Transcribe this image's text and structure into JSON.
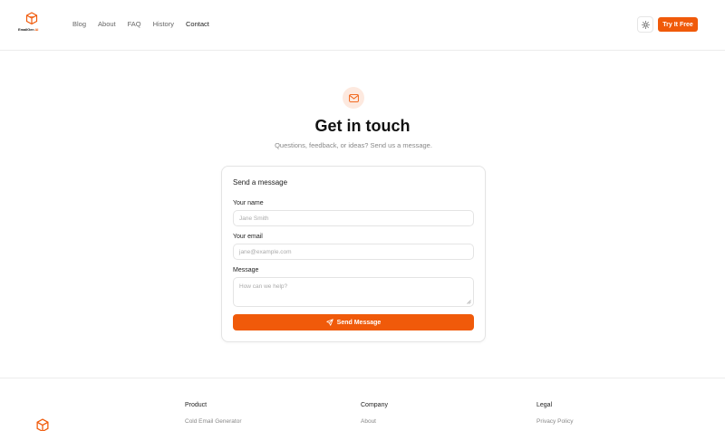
{
  "brand": {
    "name_prefix": "EmailGen",
    "name_suffix": " AI",
    "accent_color": "#f05a0a"
  },
  "nav": {
    "items": [
      {
        "label": "Blog",
        "active": false
      },
      {
        "label": "About",
        "active": false
      },
      {
        "label": "FAQ",
        "active": false
      },
      {
        "label": "History",
        "active": false
      },
      {
        "label": "Contact",
        "active": true
      }
    ]
  },
  "header": {
    "theme_toggle_icon": "sun-icon",
    "cta_label": "Try It Free"
  },
  "hero": {
    "icon": "mail-icon",
    "title": "Get in touch",
    "subtitle": "Questions, feedback, or ideas? Send us a message."
  },
  "form": {
    "title": "Send a message",
    "name_label": "Your name",
    "name_placeholder": "Jane Smith",
    "name_value": "",
    "email_label": "Your email",
    "email_placeholder": "jane@example.com",
    "email_value": "",
    "message_label": "Message",
    "message_placeholder": "How can we help?",
    "message_value": "",
    "submit_label": "Send Message",
    "submit_icon": "send-icon"
  },
  "footer": {
    "columns": [
      {
        "title": "Product",
        "first_link": "Cold Email Generator"
      },
      {
        "title": "Company",
        "first_link": "About"
      },
      {
        "title": "Legal",
        "first_link": "Privacy Policy"
      }
    ]
  }
}
